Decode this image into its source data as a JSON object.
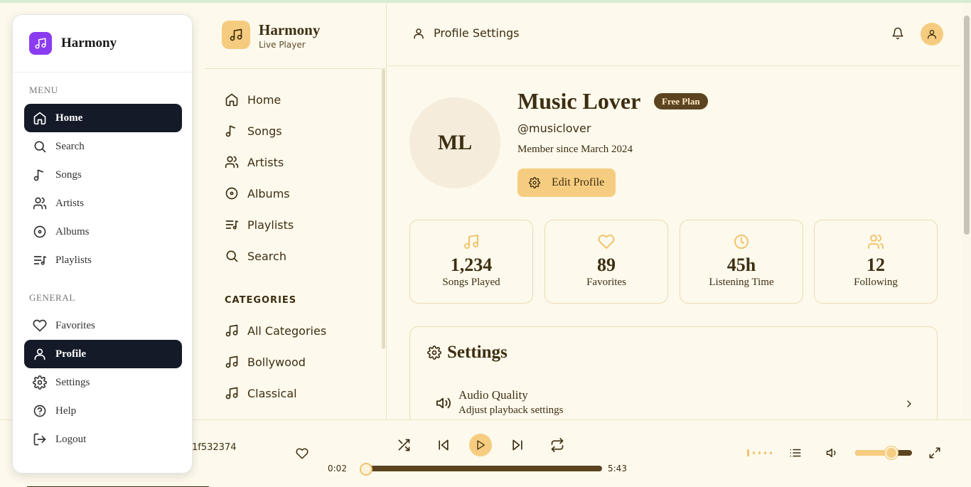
{
  "float_sidebar": {
    "brand": "Harmony",
    "menu_heading": "MENU",
    "menu_items": [
      {
        "label": "Home",
        "icon": "home-icon",
        "active": true
      },
      {
        "label": "Search",
        "icon": "search-icon",
        "active": false
      },
      {
        "label": "Songs",
        "icon": "music-note-icon",
        "active": false
      },
      {
        "label": "Artists",
        "icon": "users-icon",
        "active": false
      },
      {
        "label": "Albums",
        "icon": "disc-icon",
        "active": false
      },
      {
        "label": "Playlists",
        "icon": "playlist-icon",
        "active": false
      }
    ],
    "general_heading": "GENERAL",
    "general_items": [
      {
        "label": "Favorites",
        "icon": "heart-icon",
        "active": false
      },
      {
        "label": "Profile",
        "icon": "user-icon",
        "active": true
      },
      {
        "label": "Settings",
        "icon": "gear-icon",
        "active": false
      },
      {
        "label": "Help",
        "icon": "help-icon",
        "active": false
      },
      {
        "label": "Logout",
        "icon": "logout-icon",
        "active": false
      }
    ]
  },
  "nav_panel": {
    "title": "Harmony",
    "subtitle": "Live Player",
    "items": [
      {
        "label": "Home",
        "icon": "home-icon"
      },
      {
        "label": "Songs",
        "icon": "music-note-icon"
      },
      {
        "label": "Artists",
        "icon": "users-icon"
      },
      {
        "label": "Albums",
        "icon": "disc-icon"
      },
      {
        "label": "Playlists",
        "icon": "playlist-icon"
      },
      {
        "label": "Search",
        "icon": "search-icon"
      }
    ],
    "categories_heading": "CATEGORIES",
    "categories": [
      {
        "label": "All Categories",
        "icon": "music-icon"
      },
      {
        "label": "Bollywood",
        "icon": "music-icon"
      },
      {
        "label": "Classical",
        "icon": "music-icon"
      }
    ]
  },
  "header": {
    "title": "Profile Settings"
  },
  "profile": {
    "initials": "ML",
    "name": "Music Lover",
    "plan": "Free Plan",
    "handle": "@musiclover",
    "member_since": "Member since March 2024",
    "edit_label": "Edit Profile"
  },
  "stats": [
    {
      "value": "1,234",
      "label": "Songs Played",
      "icon": "music-icon"
    },
    {
      "value": "89",
      "label": "Favorites",
      "icon": "heart-icon"
    },
    {
      "value": "45h",
      "label": "Listening Time",
      "icon": "clock-icon"
    },
    {
      "value": "12",
      "label": "Following",
      "icon": "users-icon"
    }
  ],
  "settings": {
    "title": "Settings",
    "rows": [
      {
        "title": "Audio Quality",
        "subtitle": "Adjust playback settings",
        "icon": "speaker-icon"
      }
    ]
  },
  "player": {
    "track": "1f532374",
    "elapsed": "0:02",
    "duration": "5:43",
    "progress_fraction": 0.006,
    "volume_fraction": 0.65
  },
  "colors": {
    "background": "#fdf9ec",
    "accent": "#f6cd80",
    "text": "#3d2e12",
    "active_nav": "#141a28",
    "brand_purple": "#8b3cf1"
  }
}
